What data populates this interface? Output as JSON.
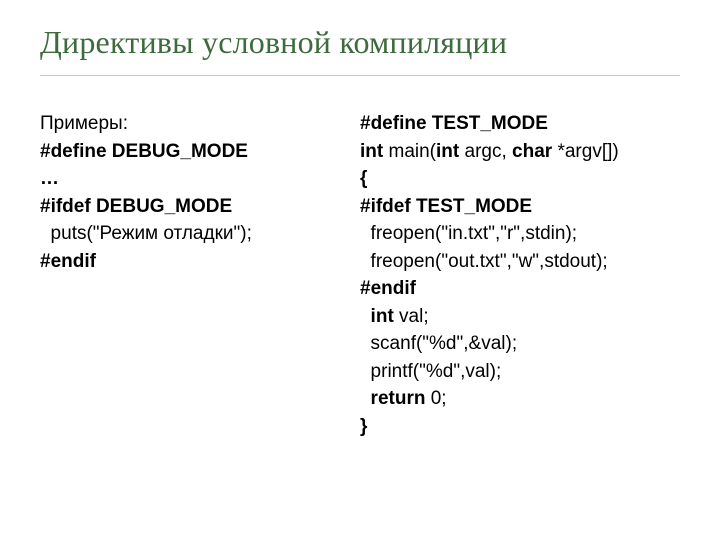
{
  "title": "Директивы условной компиляции",
  "left": {
    "l0": "Примеры:",
    "l1": "#define DEBUG_MODE",
    "l2": "…",
    "l3": "#ifdef DEBUG_MODE",
    "l4": "  puts(\"Режим отладки\");",
    "l5": "#endif"
  },
  "right": {
    "r0": {
      "a": "#define TEST_MODE"
    },
    "r1": {
      "a": "int",
      "b": " main(",
      "c": "int",
      "d": " argc, ",
      "e": "char",
      "f": " *argv[])"
    },
    "r2": {
      "a": "{"
    },
    "r3": {
      "a": "#ifdef TEST_MODE"
    },
    "r4": {
      "a": "  freopen(\"in.txt\",\"r\",stdin);"
    },
    "r5": {
      "a": "  freopen(\"out.txt\",\"w\",stdout);"
    },
    "r6": {
      "a": "#endif"
    },
    "r7": {
      "a": "  int",
      "b": " val;"
    },
    "r8": {
      "a": "  scanf(\"%d\",&val);"
    },
    "r9": {
      "a": "  printf(\"%d\",val);"
    },
    "r10": {
      "a": "  return",
      "b": " 0;"
    },
    "r11": {
      "a": "}"
    }
  }
}
